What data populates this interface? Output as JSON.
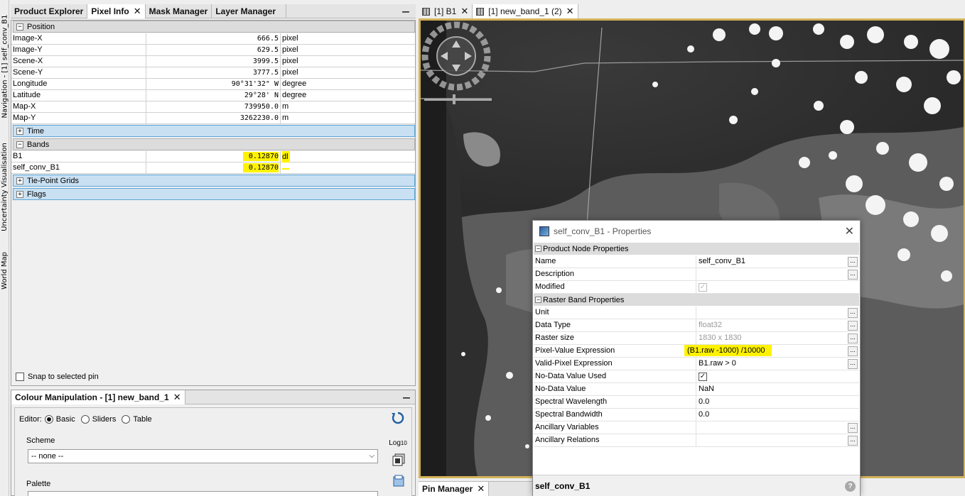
{
  "left_strip": {
    "tabs": [
      "Navigation - [1] self_conv_B1",
      "Uncertainty Visualisation",
      "World Map"
    ]
  },
  "left_tabs": [
    {
      "label": "Product Explorer",
      "closable": false,
      "active": false
    },
    {
      "label": "Pixel Info",
      "closable": true,
      "active": true
    },
    {
      "label": "Mask Manager",
      "closable": false,
      "active": false
    },
    {
      "label": "Layer Manager",
      "closable": false,
      "active": false
    }
  ],
  "pixel_info": {
    "position_group": "Position",
    "position_rows": [
      {
        "name": "Image-X",
        "value": "666.5",
        "unit": "pixel"
      },
      {
        "name": "Image-Y",
        "value": "629.5",
        "unit": "pixel"
      },
      {
        "name": "Scene-X",
        "value": "3999.5",
        "unit": "pixel"
      },
      {
        "name": "Scene-Y",
        "value": "3777.5",
        "unit": "pixel"
      },
      {
        "name": "Longitude",
        "value": "90°31'32\" W",
        "unit": "degree"
      },
      {
        "name": "Latitude",
        "value": "29°28' N",
        "unit": "degree"
      },
      {
        "name": "Map-X",
        "value": "739950.0",
        "unit": "m"
      },
      {
        "name": "Map-Y",
        "value": "3262230.0",
        "unit": "m"
      }
    ],
    "time_group": "Time",
    "bands_group": "Bands",
    "band_rows": [
      {
        "name": "B1",
        "value": "0.12870",
        "unit": "dl"
      },
      {
        "name": "self_conv_B1",
        "value": "0.12870",
        "unit": ""
      }
    ],
    "tiepoint_group": "Tie-Point Grids",
    "flags_group": "Flags",
    "snap_label": "Snap to selected pin"
  },
  "colour_manip": {
    "tab_label": "Colour Manipulation - [1] new_band_1",
    "editor_label": "Editor:",
    "modes": [
      "Basic",
      "Sliders",
      "Table"
    ],
    "selected_mode": "Basic",
    "scheme_label": "Scheme",
    "scheme_value": "-- none --",
    "palette_label": "Palette",
    "log_label": "Log",
    "log_sub": "10"
  },
  "view_tabs": [
    {
      "label": "[1] B1",
      "active": false
    },
    {
      "label": "[1] new_band_1 (2)",
      "active": true
    }
  ],
  "pin_manager": {
    "label": "Pin Manager"
  },
  "dialog": {
    "title": "self_conv_B1 - Properties",
    "group1": "Product Node Properties",
    "rows1": [
      {
        "key": "Name",
        "value": "self_conv_B1",
        "gray": false,
        "dots": true,
        "check": false
      },
      {
        "key": "Description",
        "value": "",
        "gray": false,
        "dots": true,
        "check": false
      },
      {
        "key": "Modified",
        "value": "",
        "gray": true,
        "dots": false,
        "check": true
      }
    ],
    "group2": "Raster Band Properties",
    "rows2": [
      {
        "key": "Unit",
        "value": "",
        "gray": false,
        "dots": true,
        "check": false
      },
      {
        "key": "Data Type",
        "value": "float32",
        "gray": true,
        "dots": true,
        "check": false
      },
      {
        "key": "Raster size",
        "value": "1830 x 1830",
        "gray": true,
        "dots": true,
        "check": false
      },
      {
        "key": "Pixel-Value Expression",
        "value": "(B1.raw -1000) /10000",
        "gray": false,
        "dots": true,
        "check": false,
        "highlight": true
      },
      {
        "key": "Valid-Pixel Expression",
        "value": "B1.raw > 0",
        "gray": false,
        "dots": true,
        "check": false
      },
      {
        "key": "No-Data Value Used",
        "value": "",
        "gray": false,
        "dots": false,
        "check": true
      },
      {
        "key": "No-Data Value",
        "value": "NaN",
        "gray": false,
        "dots": false,
        "check": false
      },
      {
        "key": "Spectral Wavelength",
        "value": "0.0",
        "gray": false,
        "dots": false,
        "check": false
      },
      {
        "key": "Spectral Bandwidth",
        "value": "0.0",
        "gray": false,
        "dots": false,
        "check": false
      },
      {
        "key": "Ancillary Variables",
        "value": "",
        "gray": false,
        "dots": true,
        "check": false
      },
      {
        "key": "Ancillary Relations",
        "value": "",
        "gray": false,
        "dots": true,
        "check": false
      }
    ],
    "footer": "self_conv_B1",
    "help": "?"
  }
}
